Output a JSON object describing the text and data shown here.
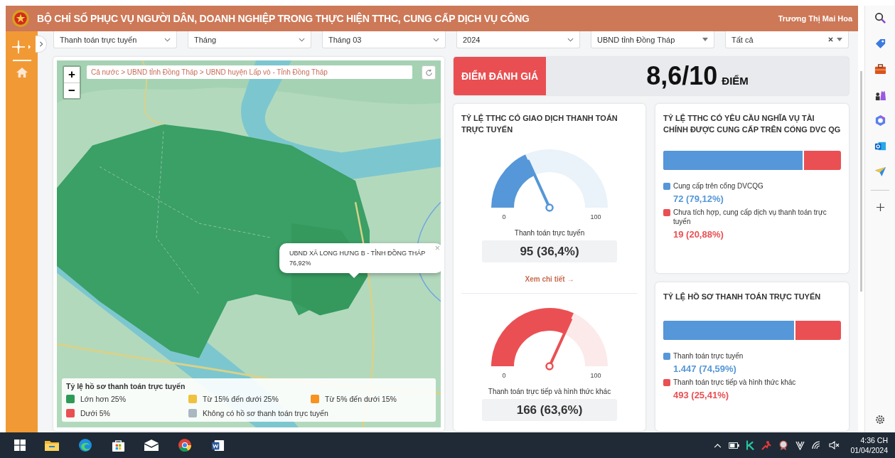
{
  "header": {
    "title": "BỘ CHỈ SỐ PHỤC VỤ NGƯỜI DÂN, DOANH NGHIỆP TRONG THỰC HIỆN TTHC, CUNG CẤP DỊCH VỤ CÔNG",
    "user": "Trương Thị Mai Hoa"
  },
  "filters": [
    {
      "value": "Thanh toán trực tuyến",
      "kind": "chevron"
    },
    {
      "value": "Tháng",
      "kind": "chevron"
    },
    {
      "value": "Tháng 03",
      "kind": "chevron"
    },
    {
      "value": "2024",
      "kind": "chevron"
    },
    {
      "value": "UBND tỉnh Đồng Tháp",
      "kind": "caret"
    },
    {
      "value": "Tất cả",
      "kind": "clearable"
    }
  ],
  "map": {
    "breadcrumb": "Cả nước > UBND tỉnh Đồng Tháp > UBND huyện Lấp vò - Tỉnh Đồng Tháp",
    "zoom_in": "+",
    "zoom_out": "−",
    "tooltip": {
      "title": "UBND XÃ LONG HƯNG B - TỈNH ĐỒNG THÁP",
      "value": "76,92%",
      "close": "×"
    },
    "legend": {
      "title": "Tỷ lệ hồ sơ thanh toán trực tuyến",
      "items": [
        {
          "label": "Lớn hơn 25%",
          "color": "#2e9a57"
        },
        {
          "label": "Từ 15% đến dưới 25%",
          "color": "#f0c13c"
        },
        {
          "label": "Từ 5% đến dưới 15%",
          "color": "#f7931e"
        },
        {
          "label": "Dưới 5%",
          "color": "#ea4f52"
        },
        {
          "label": "Không có hồ sơ thanh toán trực tuyến",
          "color": "#aab8c2"
        }
      ]
    }
  },
  "score": {
    "label": "ĐIỂM ĐÁNH GIÁ",
    "value": "8,6/10",
    "unit": "ĐIỂM"
  },
  "gauge_card": {
    "title": "TỶ LỆ TTHC CÓ GIAO DỊCH THANH TOÁN TRỰC TUYẾN",
    "link": "Xem chi tiết →",
    "gauges": [
      {
        "label": "Thanh toán trực tuyến",
        "value": "95 (36,4%)",
        "color": "#5597d8",
        "min": "0",
        "max": "100"
      },
      {
        "label": "Thanh toán trực tiếp và hình thức khác",
        "value": "166 (63,6%)",
        "color": "#ea5053",
        "min": "0",
        "max": "100"
      }
    ]
  },
  "bar_cards": [
    {
      "title": "TỶ LỆ TTHC CÓ YÊU CẦU NGHĨA VỤ TÀI CHÍNH ĐƯỢC CUNG CẤP TRÊN CỔNG DVC QG",
      "level": 0.7912,
      "segments": [
        {
          "label": "Cung cấp trên cổng DVCQG",
          "value": "72 (79,12%)",
          "color": "#5597d8"
        },
        {
          "label": "Chưa tích hợp, cung cấp dịch vụ thanh toán trực tuyến",
          "value": "19 (20,88%)",
          "color": "#ea5053"
        }
      ]
    },
    {
      "title": "TỶ LỆ HỒ SƠ THANH TOÁN TRỰC TUYẾN",
      "level": 0.7459,
      "segments": [
        {
          "label": "Thanh toán trực tuyến",
          "value": "1.447 (74,59%)",
          "color": "#5597d8"
        },
        {
          "label": "Thanh toán trực tiếp và hình thức khác",
          "value": "493 (25,41%)",
          "color": "#ea5053"
        }
      ]
    }
  ],
  "taskbar": {
    "time": "4:36 CH",
    "date": "01/04/2024"
  }
}
